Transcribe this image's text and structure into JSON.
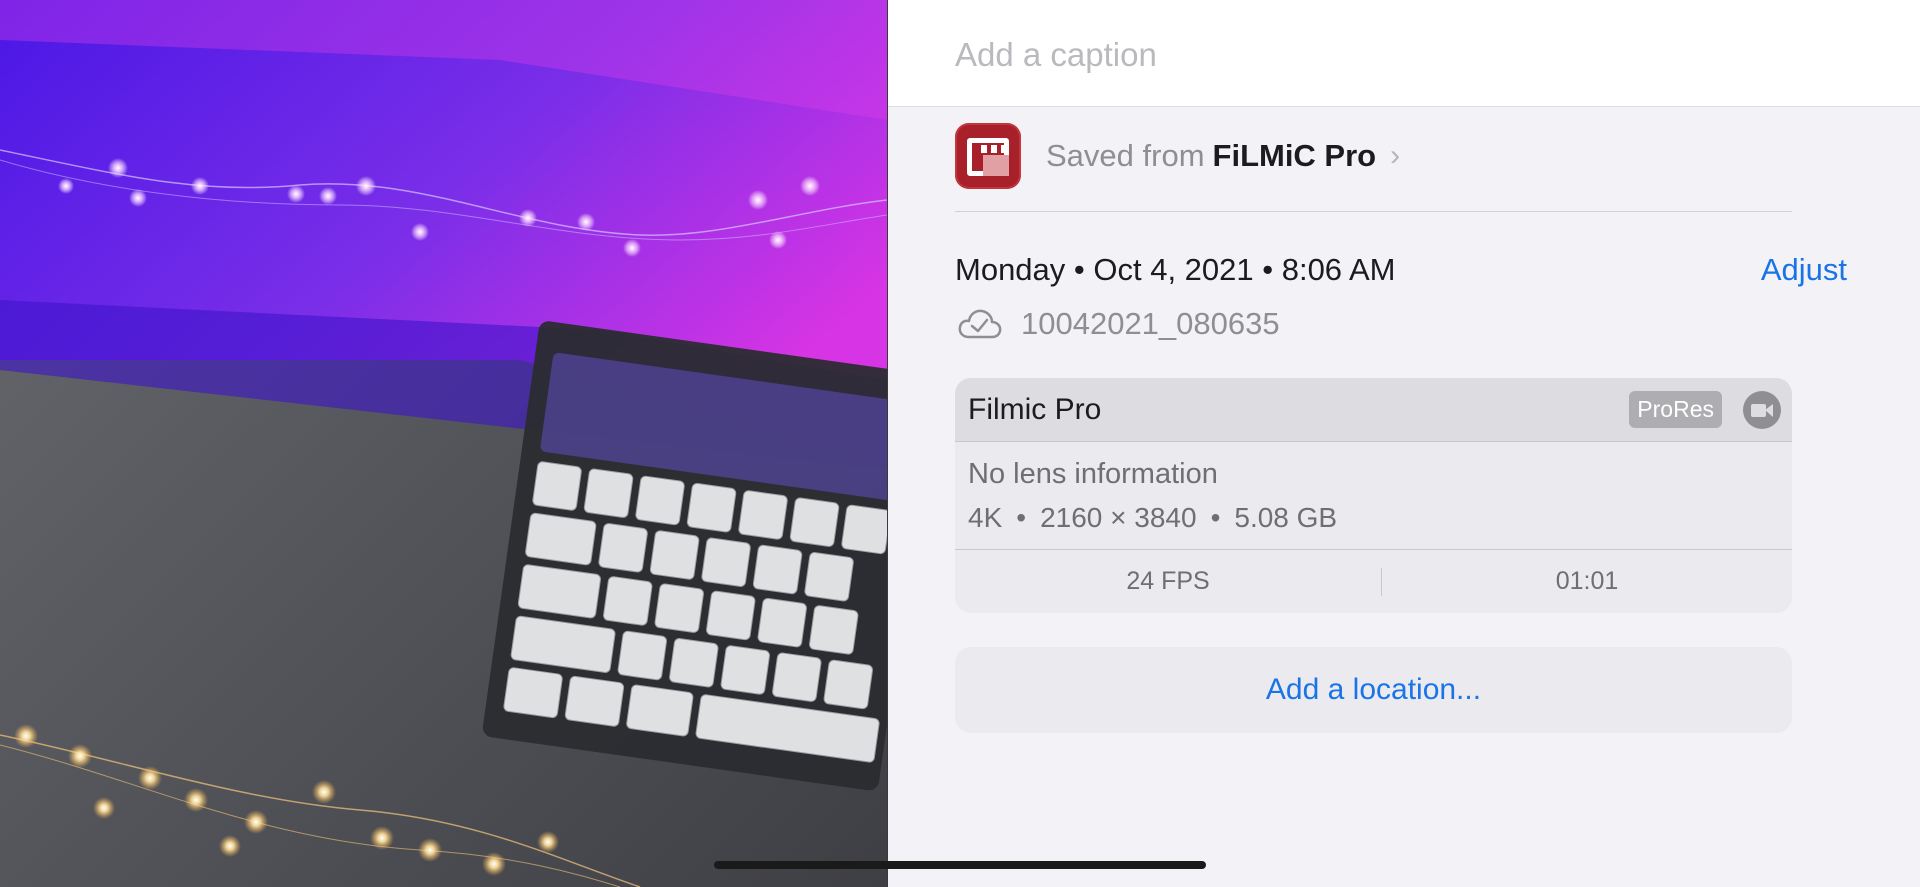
{
  "caption": {
    "placeholder": "Add a caption",
    "value": ""
  },
  "source": {
    "prefix": "Saved from",
    "app_name": "FiLMiC Pro",
    "chevron": "›",
    "app_icon": "filmic-pro-app-icon"
  },
  "date": {
    "line": "Monday • Oct 4, 2021 • 8:06 AM",
    "adjust_label": "Adjust"
  },
  "file": {
    "icon": "icloud-check-icon",
    "name": "10042021_080635"
  },
  "camera": {
    "name": "Filmic Pro",
    "badge": "ProRes",
    "type_icon": "video-camera-icon",
    "lens": "No lens information",
    "specs": [
      "4K",
      "2160 × 3840",
      "5.08 GB"
    ],
    "spec_separator": "•",
    "fps": "24 FPS",
    "duration": "01:01"
  },
  "location": {
    "label": "Add a location..."
  },
  "colors": {
    "accent": "#1a74e8",
    "app_icon_red": "#a8212a",
    "panel_bg": "#f2f2f7"
  }
}
